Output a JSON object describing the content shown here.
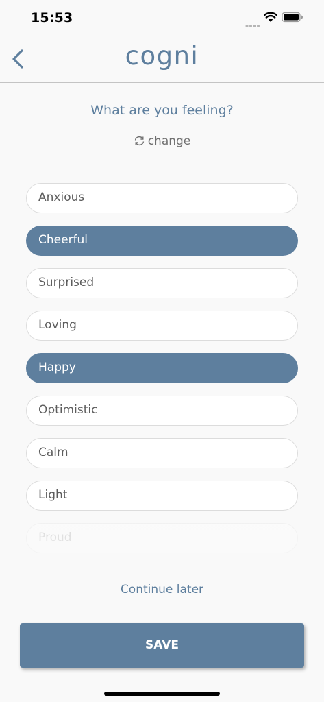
{
  "status_bar": {
    "time": "15:53"
  },
  "header": {
    "logo": "cogni",
    "back_icon": "chevron-left-icon"
  },
  "prompt": {
    "question": "What are you feeling?",
    "change_label": "change",
    "change_icon": "refresh-icon"
  },
  "options": [
    {
      "label": "Anxious",
      "selected": false
    },
    {
      "label": "Cheerful",
      "selected": true
    },
    {
      "label": "Surprised",
      "selected": false
    },
    {
      "label": "Loving",
      "selected": false
    },
    {
      "label": "Happy",
      "selected": true
    },
    {
      "label": "Optimistic",
      "selected": false
    },
    {
      "label": "Calm",
      "selected": false
    },
    {
      "label": "Light",
      "selected": false
    },
    {
      "label": "Proud",
      "selected": false
    }
  ],
  "footer": {
    "continue_label": "Continue later",
    "save_label": "SAVE"
  },
  "colors": {
    "accent": "#5e7f9e",
    "background": "#f9f9f9",
    "text_muted": "#5d5d5d"
  }
}
